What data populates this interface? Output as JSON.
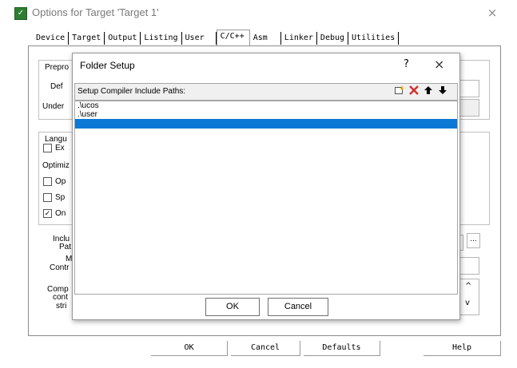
{
  "window": {
    "title": "Options for Target 'Target 1'",
    "close_glyph": "×",
    "icon_glyph": "✓"
  },
  "tabs": [
    {
      "label": "Device"
    },
    {
      "label": "Target"
    },
    {
      "label": "Output"
    },
    {
      "label": "Listing"
    },
    {
      "label": "User"
    },
    {
      "label": "C/C++"
    },
    {
      "label": "Asm"
    },
    {
      "label": "Linker"
    },
    {
      "label": "Debug"
    },
    {
      "label": "Utilities"
    }
  ],
  "active_tab": "C/C++",
  "background_panel": {
    "preprocessor_label": "Prepro",
    "define_label": "Def",
    "undefine_label": "Under",
    "language_label": "Langu",
    "ex_label": "Ex",
    "optimization_label": "Optimiz",
    "op_label": "Op",
    "sp_label": "Sp",
    "on_label": "On",
    "include_label_1": "Inclu",
    "include_label_2": "Pat",
    "misc_label_1": "M",
    "misc_label_2": "Contr",
    "compiler_label_1": "Comp",
    "compiler_label_2": "cont",
    "compiler_label_3": "stri",
    "browse_label": "...",
    "scroll_up": "^",
    "scroll_down": "v"
  },
  "bottom_buttons": {
    "ok": "OK",
    "cancel": "Cancel",
    "defaults": "Defaults",
    "help": "Help"
  },
  "dialog": {
    "title": "Folder Setup",
    "help_glyph": "?",
    "close_glyph": "×",
    "list_header": "Setup Compiler Include Paths:",
    "items": [
      {
        "text": ".\\ucos"
      },
      {
        "text": ".\\user"
      }
    ],
    "ok_label": "OK",
    "cancel_label": "Cancel"
  },
  "colors": {
    "selection": "#0a78d4",
    "delete_icon": "#d32f2f",
    "new_icon": "#e0b000"
  }
}
